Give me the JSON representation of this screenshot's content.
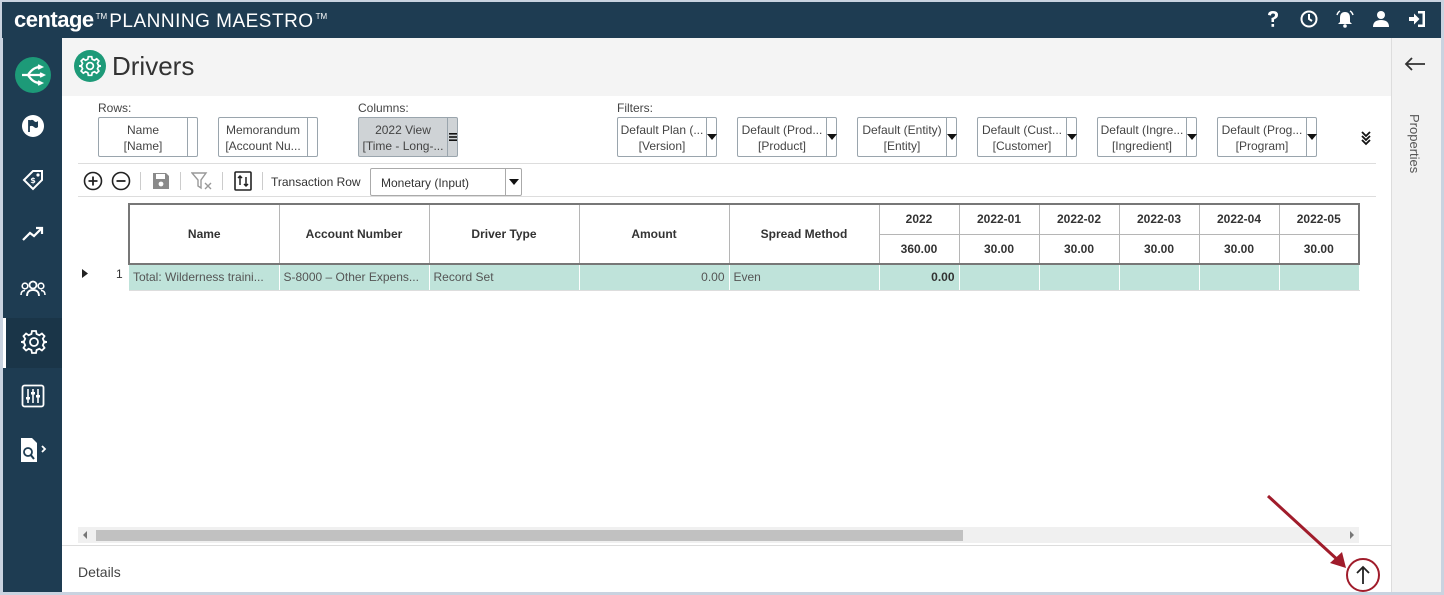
{
  "app": {
    "brand_main": "centage",
    "brand_tm1": "TM",
    "brand_product": "PLANNING MAESTRO",
    "brand_tm2": "TM"
  },
  "page": {
    "title": "Drivers"
  },
  "sections": {
    "rows_label": "Rows:",
    "columns_label": "Columns:",
    "filters_label": "Filters:"
  },
  "rows": [
    {
      "line1": "Name",
      "line2": "[Name]"
    },
    {
      "line1": "Memorandum",
      "line2": "[Account Nu..."
    }
  ],
  "columns": [
    {
      "line1": "2022 View",
      "line2": "[Time - Long-..."
    }
  ],
  "filters": [
    {
      "line1": "Default Plan (...",
      "line2": "[Version]"
    },
    {
      "line1": "Default (Prod...",
      "line2": "[Product]"
    },
    {
      "line1": "Default (Entity)",
      "line2": "[Entity]"
    },
    {
      "line1": "Default (Cust...",
      "line2": "[Customer]"
    },
    {
      "line1": "Default (Ingre...",
      "line2": "[Ingredient]"
    },
    {
      "line1": "Default (Prog...",
      "line2": "[Program]"
    }
  ],
  "toolbar": {
    "transaction_row_label": "Transaction Row",
    "mode_value": "Monetary (Input)"
  },
  "table": {
    "headers": [
      "Name",
      "Account Number",
      "Driver Type",
      "Amount",
      "Spread Method"
    ],
    "periods": [
      {
        "label": "2022",
        "total": "360.00"
      },
      {
        "label": "2022-01",
        "total": "30.00"
      },
      {
        "label": "2022-02",
        "total": "30.00"
      },
      {
        "label": "2022-03",
        "total": "30.00"
      },
      {
        "label": "2022-04",
        "total": "30.00"
      },
      {
        "label": "2022-05",
        "total": "30.00"
      }
    ],
    "rows": [
      {
        "index": "1",
        "name": "Total: Wilderness traini...",
        "account": "S-8000 – Other Expens...",
        "driver_type": "Record Set",
        "amount": "0.00",
        "spread": "Even",
        "values": [
          "0.00",
          "",
          "",
          "",
          "",
          ""
        ]
      }
    ]
  },
  "details": {
    "label": "Details"
  },
  "properties": {
    "label": "Properties"
  },
  "colors": {
    "nav_bg": "#1e3c52",
    "accent": "#1d9a78",
    "row_highlight": "#bfe3da",
    "annotation": "#a01c2b"
  }
}
